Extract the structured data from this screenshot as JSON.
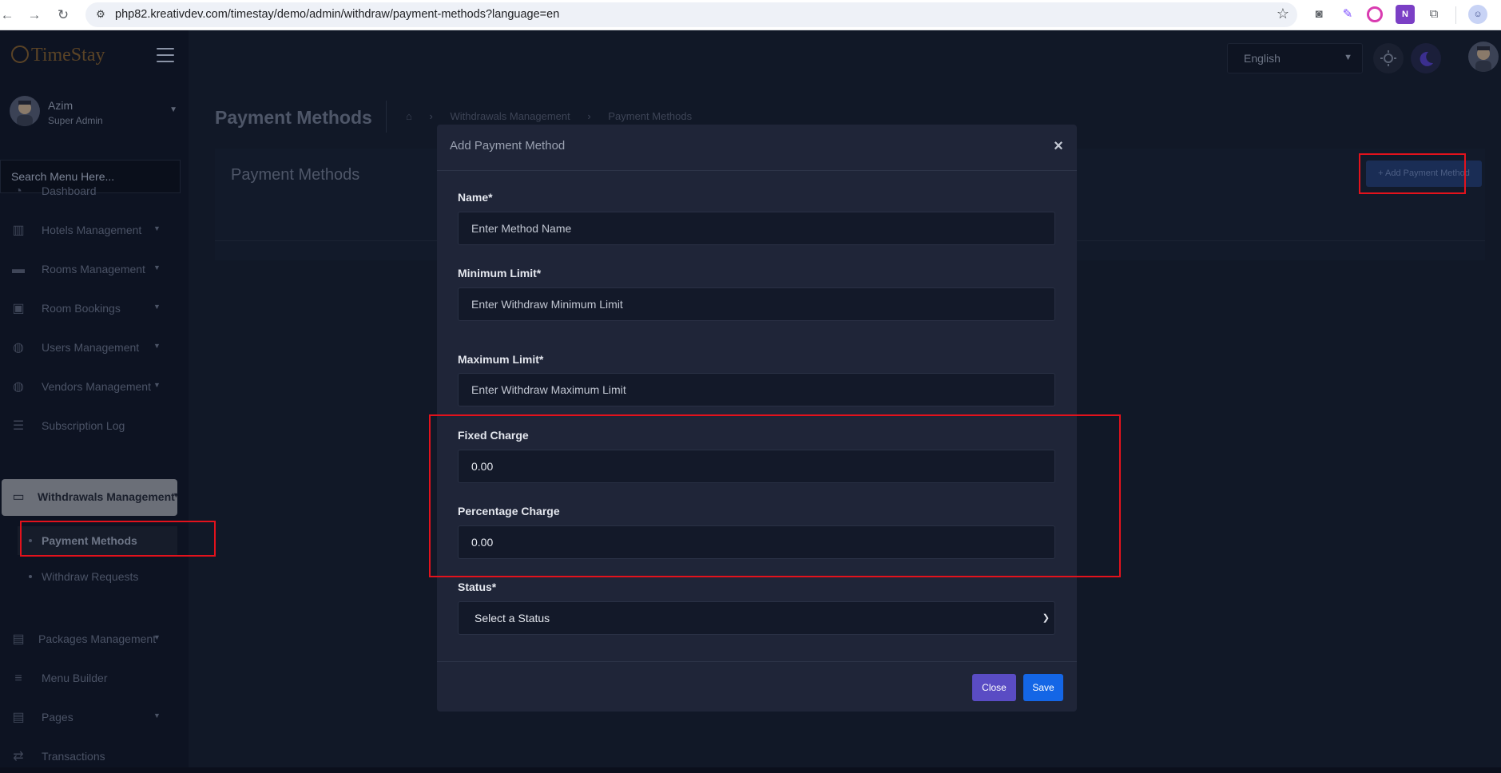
{
  "browser": {
    "url": "php82.kreativdev.com/timestay/demo/admin/withdraw/payment-methods?language=en"
  },
  "brand": {
    "name": "TimeStay"
  },
  "profile": {
    "name": "Azim",
    "role": "Super Admin"
  },
  "sidebar": {
    "search_placeholder": "Search Menu Here...",
    "items": [
      {
        "label": "Dashboard",
        "icon": "palette-icon",
        "has_caret": false
      },
      {
        "label": "Hotels Management",
        "icon": "building-icon",
        "has_caret": true
      },
      {
        "label": "Rooms Management",
        "icon": "bed-icon",
        "has_caret": true
      },
      {
        "label": "Room Bookings",
        "icon": "calendar-check-icon",
        "has_caret": true
      },
      {
        "label": "Users Management",
        "icon": "users-icon",
        "has_caret": true
      },
      {
        "label": "Vendors Management",
        "icon": "vendors-icon",
        "has_caret": true
      },
      {
        "label": "Subscription Log",
        "icon": "list-icon",
        "has_caret": false
      }
    ],
    "active": {
      "label": "Withdrawals Management",
      "icon": "credit-card-icon"
    },
    "sub_items": [
      {
        "label": "Payment Methods",
        "active": true
      },
      {
        "label": "Withdraw Requests",
        "active": false
      }
    ],
    "items_after": [
      {
        "label": "Packages Management",
        "icon": "file-list-icon",
        "has_caret": true
      },
      {
        "label": "Menu Builder",
        "icon": "bars-icon",
        "has_caret": false
      },
      {
        "label": "Pages",
        "icon": "pages-icon",
        "has_caret": true
      },
      {
        "label": "Transactions",
        "icon": "exchange-icon",
        "has_caret": false
      }
    ]
  },
  "header": {
    "language": "English"
  },
  "page": {
    "title": "Payment Methods",
    "breadcrumb": [
      "Withdrawals Management",
      "Payment Methods"
    ],
    "card_title": "Payment Methods",
    "add_button": "+ Add Payment Method"
  },
  "modal": {
    "title": "Add Payment Method",
    "close_symbol": "×",
    "fields": {
      "name": {
        "label": "Name*",
        "placeholder": "Enter Method Name"
      },
      "min_limit": {
        "label": "Minimum Limit*",
        "placeholder": "Enter Withdraw Minimum Limit"
      },
      "max_limit": {
        "label": "Maximum Limit*",
        "placeholder": "Enter Withdraw Maximum Limit"
      },
      "fixed_charge": {
        "label": "Fixed Charge",
        "value": "0.00"
      },
      "percentage_charge": {
        "label": "Percentage Charge",
        "value": "0.00"
      },
      "status": {
        "label": "Status*",
        "selected": "Select a Status"
      }
    },
    "buttons": {
      "close": "Close",
      "save": "Save"
    }
  },
  "colors": {
    "annotation": "#e3121c",
    "save": "#1466e6",
    "close": "#5a4cc4"
  }
}
